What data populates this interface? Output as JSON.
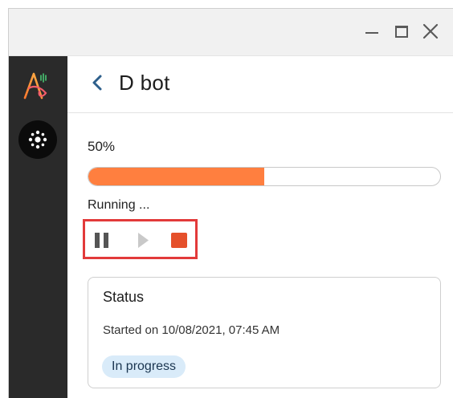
{
  "app": {
    "title": "D bot"
  },
  "window_controls": {
    "minimize_icon": "minimize-icon",
    "maximize_icon": "maximize-icon",
    "close_icon": "close-icon"
  },
  "sidebar": {
    "logo_icon": "app-logo-icon",
    "items": [
      {
        "icon": "hub-icon"
      }
    ]
  },
  "header": {
    "back_icon": "chevron-left-icon",
    "title": "D bot"
  },
  "progress": {
    "label": "50%",
    "value": 0.5,
    "fill_color": "#ff7f3f"
  },
  "run": {
    "status_text": "Running ..."
  },
  "controls": {
    "pause_icon": "pause-icon",
    "play_icon": "play-icon",
    "stop_icon": "stop-icon",
    "stop_color": "#e5502b",
    "highlight_color": "#e23a3a"
  },
  "status_card": {
    "title": "Status",
    "started": "Started on 10/08/2021, 07:45 AM",
    "badge": "In progress",
    "badge_color": "#d9ebf9"
  }
}
